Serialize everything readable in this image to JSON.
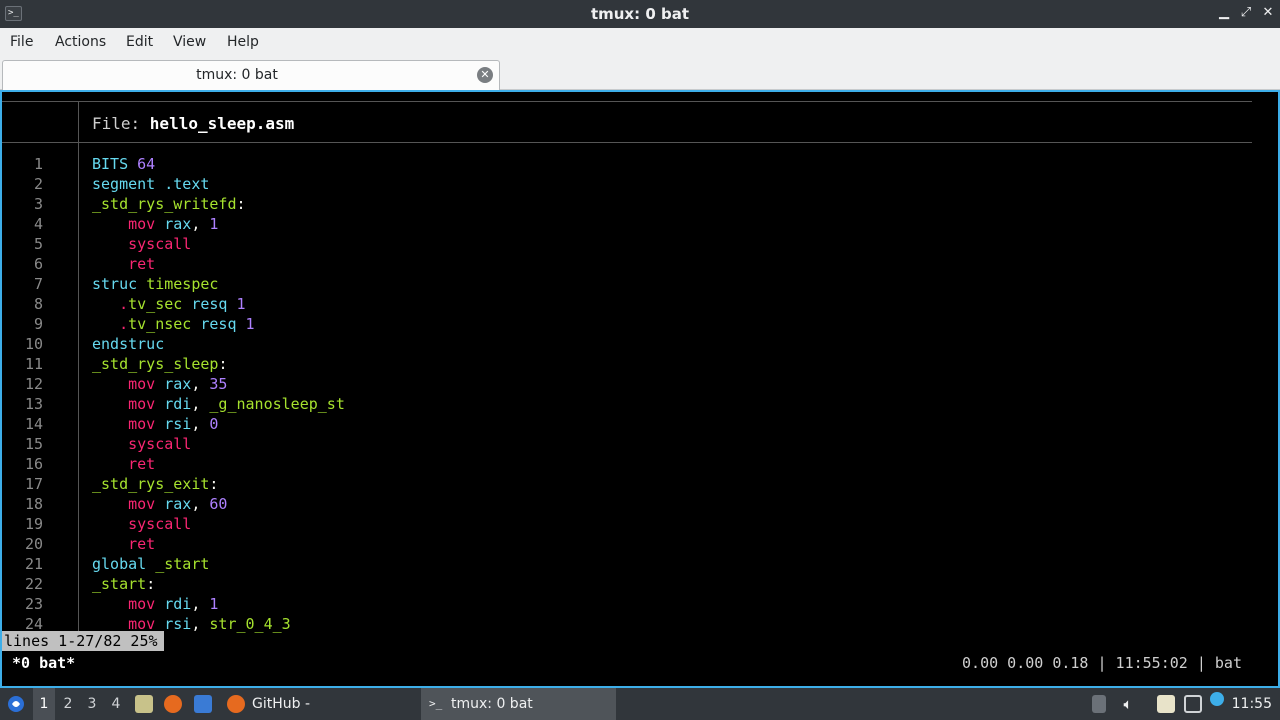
{
  "window": {
    "title": "tmux: 0 bat",
    "app_icon_glyph": ">_",
    "controls": {
      "minimize": "▁",
      "restore": "⤢",
      "close": "✕"
    }
  },
  "menu": [
    "File",
    "Actions",
    "Edit",
    "View",
    "Help"
  ],
  "tab": {
    "label": "tmux: 0 bat",
    "close_glyph": "✕"
  },
  "bat": {
    "file_prefix": "File: ",
    "file_name": "hello_sleep.asm",
    "lines": [
      {
        "n": "1",
        "parts": [
          [
            "kw-blue",
            "BITS "
          ],
          [
            "num",
            "64"
          ]
        ]
      },
      {
        "n": "2",
        "parts": [
          [
            "kw-blue",
            "segment .text"
          ]
        ]
      },
      {
        "n": "3",
        "parts": [
          [
            "kw-green",
            "_std_rys_writefd"
          ],
          [
            "plain",
            ":"
          ]
        ]
      },
      {
        "n": "4",
        "parts": [
          [
            "plain",
            "    "
          ],
          [
            "kw-pink",
            "mov"
          ],
          [
            "kw-blue",
            " rax"
          ],
          [
            "plain",
            ", "
          ],
          [
            "num",
            "1"
          ]
        ]
      },
      {
        "n": "5",
        "parts": [
          [
            "plain",
            "    "
          ],
          [
            "kw-pink",
            "syscall"
          ]
        ]
      },
      {
        "n": "6",
        "parts": [
          [
            "plain",
            "    "
          ],
          [
            "kw-pink",
            "ret"
          ]
        ]
      },
      {
        "n": "7",
        "parts": [
          [
            "kw-blue",
            "struc "
          ],
          [
            "kw-green",
            "timespec"
          ]
        ]
      },
      {
        "n": "8",
        "parts": [
          [
            "plain",
            "   "
          ],
          [
            "dot-red",
            "."
          ],
          [
            "kw-green",
            "tv_sec"
          ],
          [
            "kw-blue",
            " resq "
          ],
          [
            "num",
            "1"
          ]
        ]
      },
      {
        "n": "9",
        "parts": [
          [
            "plain",
            "   "
          ],
          [
            "dot-red",
            "."
          ],
          [
            "kw-green",
            "tv_nsec"
          ],
          [
            "kw-blue",
            " resq "
          ],
          [
            "num",
            "1"
          ]
        ]
      },
      {
        "n": "10",
        "parts": [
          [
            "kw-blue",
            "endstruc"
          ]
        ]
      },
      {
        "n": "11",
        "parts": [
          [
            "kw-green",
            "_std_rys_sleep"
          ],
          [
            "plain",
            ":"
          ]
        ]
      },
      {
        "n": "12",
        "parts": [
          [
            "plain",
            "    "
          ],
          [
            "kw-pink",
            "mov"
          ],
          [
            "kw-blue",
            " rax"
          ],
          [
            "plain",
            ", "
          ],
          [
            "num",
            "35"
          ]
        ]
      },
      {
        "n": "13",
        "parts": [
          [
            "plain",
            "    "
          ],
          [
            "kw-pink",
            "mov"
          ],
          [
            "kw-blue",
            " rdi"
          ],
          [
            "plain",
            ", "
          ],
          [
            "kw-green",
            "_g_nanosleep_st"
          ]
        ]
      },
      {
        "n": "14",
        "parts": [
          [
            "plain",
            "    "
          ],
          [
            "kw-pink",
            "mov"
          ],
          [
            "kw-blue",
            " rsi"
          ],
          [
            "plain",
            ", "
          ],
          [
            "num",
            "0"
          ]
        ]
      },
      {
        "n": "15",
        "parts": [
          [
            "plain",
            "    "
          ],
          [
            "kw-pink",
            "syscall"
          ]
        ]
      },
      {
        "n": "16",
        "parts": [
          [
            "plain",
            "    "
          ],
          [
            "kw-pink",
            "ret"
          ]
        ]
      },
      {
        "n": "17",
        "parts": [
          [
            "kw-green",
            "_std_rys_exit"
          ],
          [
            "plain",
            ":"
          ]
        ]
      },
      {
        "n": "18",
        "parts": [
          [
            "plain",
            "    "
          ],
          [
            "kw-pink",
            "mov"
          ],
          [
            "kw-blue",
            " rax"
          ],
          [
            "plain",
            ", "
          ],
          [
            "num",
            "60"
          ]
        ]
      },
      {
        "n": "19",
        "parts": [
          [
            "plain",
            "    "
          ],
          [
            "kw-pink",
            "syscall"
          ]
        ]
      },
      {
        "n": "20",
        "parts": [
          [
            "plain",
            "    "
          ],
          [
            "kw-pink",
            "ret"
          ]
        ]
      },
      {
        "n": "21",
        "parts": [
          [
            "kw-blue",
            "global "
          ],
          [
            "kw-green",
            "_start"
          ]
        ]
      },
      {
        "n": "22",
        "parts": [
          [
            "kw-green",
            "_start"
          ],
          [
            "plain",
            ":"
          ]
        ]
      },
      {
        "n": "23",
        "parts": [
          [
            "plain",
            "    "
          ],
          [
            "kw-pink",
            "mov"
          ],
          [
            "kw-blue",
            " rdi"
          ],
          [
            "plain",
            ", "
          ],
          [
            "num",
            "1"
          ]
        ]
      },
      {
        "n": "24",
        "parts": [
          [
            "plain",
            "    "
          ],
          [
            "kw-pink",
            "mov"
          ],
          [
            "kw-blue",
            " rsi"
          ],
          [
            "plain",
            ", "
          ],
          [
            "kw-green",
            "str_0_4_3"
          ]
        ]
      }
    ]
  },
  "less_status": "lines 1-27/82 25%",
  "tmux": {
    "left": "*0 bat*",
    "right": "0.00 0.00 0.18 | 11:55:02 | bat"
  },
  "taskbar": {
    "desktops": [
      "1",
      "2",
      "3",
      "4"
    ],
    "tasks": [
      {
        "label": "GitHub - Peltoche/lsd:..."
      },
      {
        "label": "tmux: 0 bat"
      }
    ],
    "clock": "11:55"
  },
  "colors": {
    "accent": "#3daee9",
    "keyword_pink": "#f92672",
    "ident_green": "#a6e22e",
    "keyword_blue": "#66d9ef",
    "number_purple": "#ae81ff"
  }
}
